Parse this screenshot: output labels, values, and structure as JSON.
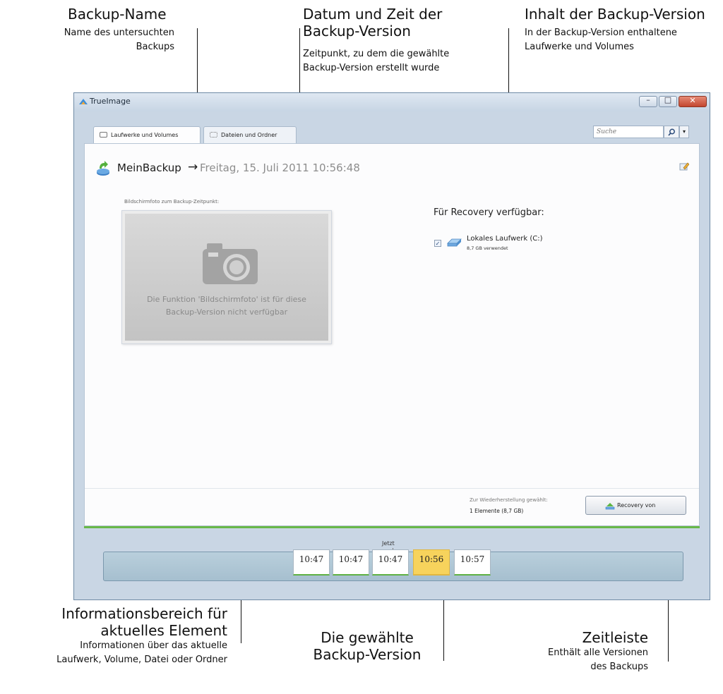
{
  "annotations": {
    "backup_name": {
      "title": "Backup-Name",
      "sub1": "Name des untersuchten",
      "sub2": "Backups"
    },
    "datetime": {
      "title1": "Datum und Zeit der",
      "title2": "Backup-Version",
      "sub1": "Zeitpunkt, zu dem die gewählte",
      "sub2": "Backup-Version erstellt wurde"
    },
    "content": {
      "title": "Inhalt der Backup-Version",
      "sub1": "In der Backup-Version enthaltene",
      "sub2": "Laufwerke und Volumes"
    },
    "info_area": {
      "title1": "Informationsbereich für",
      "title2": "aktuelles Element",
      "sub1": "Informationen über das aktuelle",
      "sub2": "Laufwerk, Volume, Datei oder Ordner"
    },
    "selected": {
      "title1": "Die gewählte",
      "title2": "Backup-Version"
    },
    "timeline": {
      "title": "Zeitleiste",
      "sub1": "Enthält alle Versionen",
      "sub2": "des Backups"
    }
  },
  "window": {
    "title": "TrueImage",
    "min_glyph": "–",
    "max_glyph": "□",
    "close_glyph": "✕"
  },
  "tabs": [
    {
      "label": "Laufwerke und Volumes",
      "icon": "drive-icon",
      "active": true
    },
    {
      "label": "Dateien und Ordner",
      "icon": "list-icon",
      "active": false
    }
  ],
  "search": {
    "placeholder": "Suche",
    "dropdown_glyph": "▾"
  },
  "backup": {
    "name": "MeinBackup",
    "arrow": "→",
    "date": "Freitag, 15. Juli 2011 10:56:48"
  },
  "screenshot": {
    "label": "Bildschirmfoto zum Backup-Zeitpunkt:",
    "message_line1": "Die Funktion 'Bildschirmfoto' ist für diese",
    "message_line2": "Backup-Version nicht verfügbar"
  },
  "recovery_panel": {
    "title": "Für Recovery verfügbar:",
    "drives": [
      {
        "name": "Lokales Laufwerk (C:)",
        "size": "8,7 GB verwendet",
        "checked": true,
        "check_glyph": "✓"
      }
    ]
  },
  "selection": {
    "label": "Zur Wiederherstellung gewählt:",
    "value": "1 Elemente (8,7 GB)",
    "button_label": "Recovery von"
  },
  "timeline": {
    "now_label": "Jetzt",
    "slots": [
      "10:47",
      "10:47",
      "10:47",
      "10:56",
      "10:57"
    ],
    "selected_index": 3
  },
  "colors": {
    "accent_green": "#68b848",
    "selected_slot": "#f7d35c",
    "window_frame": "#c9d6e4"
  }
}
